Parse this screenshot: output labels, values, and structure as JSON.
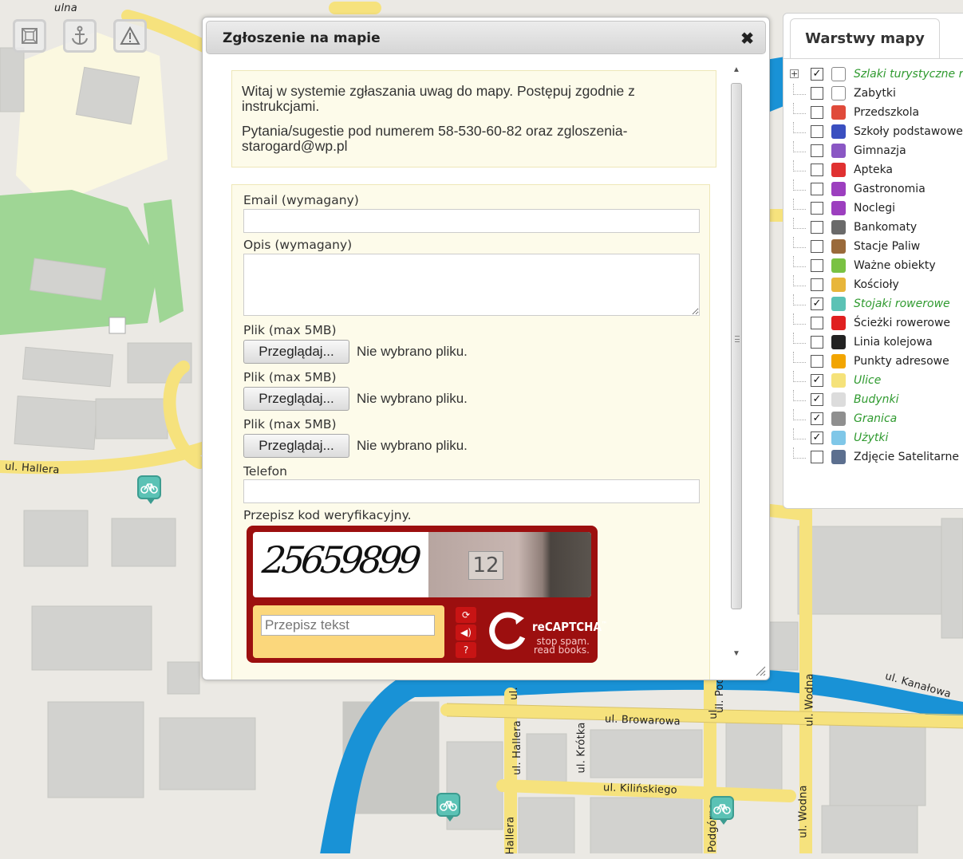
{
  "map": {
    "toolbar": [
      {
        "id": "fit-extent",
        "icon": "zoom-extent-icon"
      },
      {
        "id": "anchor",
        "icon": "anchor-icon"
      },
      {
        "id": "report",
        "icon": "warning-icon"
      }
    ],
    "streets": [
      {
        "text": "ul. Hallera"
      },
      {
        "text": "ul. Kanałowa"
      },
      {
        "text": "ul. Browarowa"
      },
      {
        "text": "ul. Kilińskiego"
      },
      {
        "text": "ul. Hallera"
      },
      {
        "text": "ul. Krótka"
      },
      {
        "text": "ul. Wodna"
      },
      {
        "text": "ul. Wodna"
      },
      {
        "text": "ul. Pod"
      },
      {
        "text": "Podgórna"
      },
      {
        "text": "Hallera"
      },
      {
        "text": "ul."
      },
      {
        "text": "ul."
      },
      {
        "text": "ulna"
      }
    ]
  },
  "dialog": {
    "title": "Zgłoszenie na mapie",
    "close_icon": "close-icon",
    "info": [
      "Witaj w systemie zgłaszania uwag do mapy. Postępuj zgodnie z instrukcjami.",
      "Pytania/sugestie pod numerem 58-530-60-82 oraz zgloszenia-starogard@wp.pl"
    ],
    "form": {
      "email_label": "Email (wymagany)",
      "email_value": "",
      "desc_label": "Opis (wymagany)",
      "desc_value": "",
      "files": [
        {
          "label": "Plik (max 5MB)",
          "button": "Przeglądaj...",
          "status": "Nie wybrano pliku."
        },
        {
          "label": "Plik (max 5MB)",
          "button": "Przeglądaj...",
          "status": "Nie wybrano pliku."
        },
        {
          "label": "Plik (max 5MB)",
          "button": "Przeglądaj...",
          "status": "Nie wybrano pliku."
        }
      ],
      "phone_label": "Telefon",
      "phone_value": "",
      "captcha_label": "Przepisz kod weryfikacyjny."
    },
    "recaptcha": {
      "word": "25659899",
      "photo_number": "12",
      "input_placeholder": "Przepisz tekst",
      "brand_re": "re",
      "brand_name": "CAPTCHA",
      "brand_tm": "™",
      "tagline_1": "stop spam.",
      "tagline_2": "read books.",
      "buttons": [
        "refresh-icon",
        "audio-icon",
        "help-icon"
      ]
    }
  },
  "layers": {
    "tab_label": "Warstwy mapy",
    "items": [
      {
        "name": "Szlaki turystyczne ro",
        "checked": true,
        "active": true,
        "expandable": true,
        "icon": "folder-icon",
        "color": "#ffffff"
      },
      {
        "name": "Zabytki",
        "checked": false,
        "active": false,
        "icon": "document-icon",
        "color": "#ffffff"
      },
      {
        "name": "Przedszkola",
        "checked": false,
        "active": false,
        "icon": "kindergarten-icon",
        "color": "#e04a3a"
      },
      {
        "name": "Szkoły podstawowe",
        "checked": false,
        "active": false,
        "icon": "school-icon",
        "color": "#3a4fc0"
      },
      {
        "name": "Gimnazja",
        "checked": false,
        "active": false,
        "icon": "high-school-icon",
        "color": "#8a57c4"
      },
      {
        "name": "Apteka",
        "checked": false,
        "active": false,
        "icon": "pharmacy-icon",
        "color": "#e03131"
      },
      {
        "name": "Gastronomia",
        "checked": false,
        "active": false,
        "icon": "restaurant-icon",
        "color": "#9c3fbf"
      },
      {
        "name": "Noclegi",
        "checked": false,
        "active": false,
        "icon": "bed-icon",
        "color": "#9c3fbf"
      },
      {
        "name": "Bankomaty",
        "checked": false,
        "active": false,
        "icon": "atm-icon",
        "color": "#6a6a6a"
      },
      {
        "name": "Stacje Paliw",
        "checked": false,
        "active": false,
        "icon": "fuel-icon",
        "color": "#9a6a3a"
      },
      {
        "name": "Ważne obiekty",
        "checked": false,
        "active": false,
        "icon": "landmark-icon",
        "color": "#7ac243"
      },
      {
        "name": "Kościoły",
        "checked": false,
        "active": false,
        "icon": "church-icon",
        "color": "#e8b63a"
      },
      {
        "name": "Stojaki rowerowe",
        "checked": true,
        "active": true,
        "icon": "bike-stand-icon",
        "color": "#5bc2b5"
      },
      {
        "name": "Ścieżki rowerowe",
        "checked": false,
        "active": false,
        "icon": "bike-path-icon",
        "color": "#e02020"
      },
      {
        "name": "Linia kolejowa",
        "checked": false,
        "active": false,
        "icon": "railway-icon",
        "color": "#222222"
      },
      {
        "name": "Punkty adresowe",
        "checked": false,
        "active": false,
        "icon": "address-point-icon",
        "color": "#f2a500"
      },
      {
        "name": "Ulice",
        "checked": true,
        "active": true,
        "icon": "street-icon",
        "color": "#f5e27a"
      },
      {
        "name": "Budynki",
        "checked": true,
        "active": true,
        "icon": "building-icon",
        "color": "#dcdcdc"
      },
      {
        "name": "Granica",
        "checked": true,
        "active": true,
        "icon": "boundary-icon",
        "color": "#8f8f8f"
      },
      {
        "name": "Użytki",
        "checked": true,
        "active": true,
        "icon": "land-use-icon",
        "color": "#7fc7e8"
      },
      {
        "name": "Zdjęcie Satelitarne",
        "checked": false,
        "active": false,
        "icon": "satellite-icon",
        "color": "#5c6f8f"
      }
    ]
  }
}
